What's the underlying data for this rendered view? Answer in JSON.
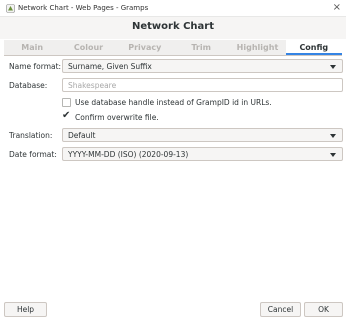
{
  "window": {
    "title": "Network Chart - Web Pages - Gramps",
    "close_glyph": "×"
  },
  "dialog": {
    "title": "Network Chart"
  },
  "tabs": [
    {
      "label": "Main",
      "active": false
    },
    {
      "label": "Colour",
      "active": false
    },
    {
      "label": "Privacy",
      "active": false
    },
    {
      "label": "Trim",
      "active": false
    },
    {
      "label": "Highlight",
      "active": false
    },
    {
      "label": "Config",
      "active": true
    }
  ],
  "form": {
    "name_format": {
      "label": "Name format:",
      "value": "Surname, Given Suffix"
    },
    "database": {
      "label": "Database:",
      "placeholder": "Shakespeare"
    },
    "use_handle": {
      "label": "Use database handle instead of GrampID id in URLs.",
      "checked": false
    },
    "confirm_overwrite": {
      "label": "Confirm overwrite file.",
      "checked": true,
      "tick": "✔"
    },
    "translation": {
      "label": "Translation:",
      "value": "Default"
    },
    "date_format": {
      "label": "Date format:",
      "value": "YYYY-MM-DD (ISO) (2020-09-13)"
    }
  },
  "buttons": {
    "help": "Help",
    "cancel": "Cancel",
    "ok": "OK"
  },
  "icons": {
    "app": "gramps-icon",
    "close": "close-icon",
    "dropdown": "chevron-down-icon"
  },
  "colors": {
    "accent": "#3584e4"
  }
}
